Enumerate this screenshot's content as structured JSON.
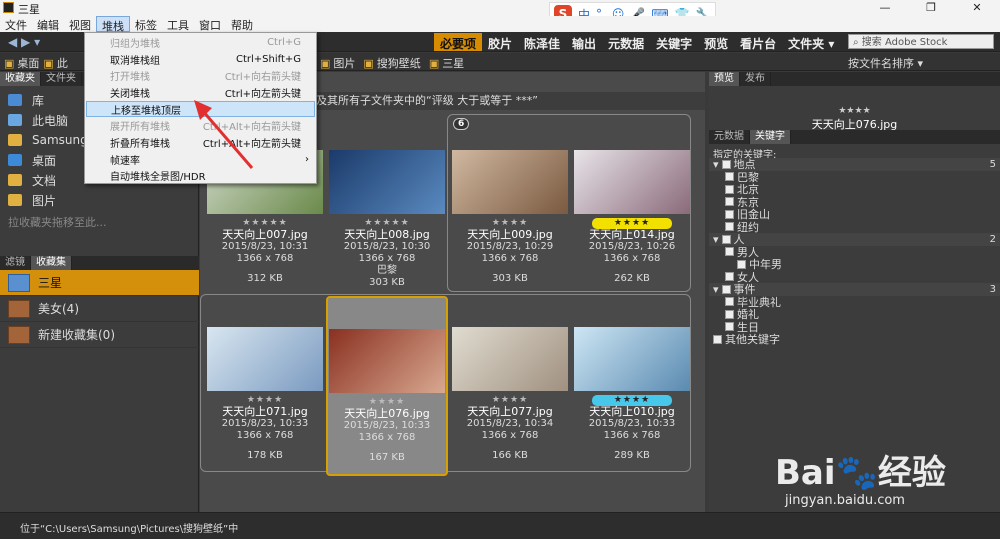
{
  "window": {
    "title": "三星",
    "controls": [
      "—",
      "❐",
      "✕"
    ]
  },
  "menubar": {
    "items": [
      "文件",
      "编辑",
      "视图",
      "堆栈",
      "标签",
      "工具",
      "窗口",
      "帮助"
    ],
    "active": "堆栈"
  },
  "ime": {
    "logo": "S",
    "items": [
      "中",
      "°,",
      "☺",
      "🎤",
      "⌨",
      "👕",
      "🔧"
    ]
  },
  "workspaces": {
    "items": [
      "必要项",
      "胶片",
      "陈泽佳",
      "输出",
      "元数据",
      "关键字",
      "预览",
      "看片台",
      "文件夹"
    ],
    "active": "必要项",
    "stock_placeholder": "搜索 Adobe Stock"
  },
  "pathbar": {
    "left": [
      "桌面",
      "此"
    ],
    "right": [
      "图片",
      "搜狗壁纸",
      "三星"
    ],
    "sort": "按文件名排序"
  },
  "stack_menu": {
    "items": [
      {
        "label": "归组为堆栈",
        "shortcut": "Ctrl+G",
        "disabled": true
      },
      {
        "label": "取消堆栈组",
        "shortcut": "Ctrl+Shift+G",
        "disabled": false
      },
      {
        "label": "打开堆栈",
        "shortcut": "Ctrl+向右箭头键",
        "disabled": true
      },
      {
        "label": "关闭堆栈",
        "shortcut": "Ctrl+向左箭头键",
        "disabled": false
      },
      {
        "label": "上移至堆栈顶层",
        "shortcut": "",
        "disabled": false,
        "highlight": true
      },
      {
        "label": "展开所有堆栈",
        "shortcut": "Ctrl+Alt+向右箭头键",
        "disabled": true
      },
      {
        "label": "折叠所有堆栈",
        "shortcut": "Ctrl+Alt+向左箭头键",
        "disabled": false
      },
      {
        "label": "帧速率",
        "shortcut": "",
        "disabled": false,
        "submenu": true
      },
      {
        "label": "自动堆栈全景图/HDR",
        "shortcut": "",
        "disabled": false
      }
    ]
  },
  "left_panel": {
    "tabs": [
      "收藏夹",
      "文件夹"
    ],
    "favorites": [
      {
        "label": "库",
        "color": "#4a8bd4"
      },
      {
        "label": "此电脑",
        "color": "#6aa6e0"
      },
      {
        "label": "Samsung",
        "color": "#e0b040"
      },
      {
        "label": "桌面",
        "color": "#3d8ad8"
      },
      {
        "label": "文档",
        "color": "#e0b040"
      },
      {
        "label": "图片",
        "color": "#e0b040"
      }
    ],
    "hint": "拉收藏夹拖移至此...",
    "bottom_tabs": [
      "滤镜",
      "收藏集"
    ],
    "collections": [
      {
        "label": "三星",
        "active": true
      },
      {
        "label": "美女(4)",
        "active": false
      },
      {
        "label": "新建收藏集(0)",
        "active": false
      }
    ]
  },
  "content": {
    "filter_text": "及其所有子文件夹中的“评级 大于或等于 ***”",
    "stack_count": "6",
    "cards": [
      {
        "name": "天天向上007.jpg",
        "date": "2015/8/23, 10:31",
        "dims": "1366 x 768",
        "size": "312 KB",
        "stars": "★★★★★",
        "badge": "",
        "loc": "",
        "img": [
          "#cfd8c8",
          "#6a8a4a"
        ]
      },
      {
        "name": "天天向上008.jpg",
        "date": "2015/8/23, 10:30",
        "dims": "1366 x 768",
        "size": "303 KB",
        "stars": "★★★★★",
        "badge": "",
        "loc": "巴黎",
        "img": [
          "#1a3a6a",
          "#5a8ac0"
        ]
      },
      {
        "name": "天天向上009.jpg",
        "date": "2015/8/23, 10:29",
        "dims": "1366 x 768",
        "size": "303 KB",
        "stars": "★★★★",
        "badge": "",
        "loc": "",
        "img": [
          "#d0b8a0",
          "#7a5a40"
        ]
      },
      {
        "name": "天天向上014.jpg",
        "date": "2015/8/23, 10:26",
        "dims": "1366 x 768",
        "size": "262 KB",
        "stars": "★★★★",
        "badge": "yellow",
        "loc": "",
        "img": [
          "#e8e4e8",
          "#8a6a7a"
        ]
      },
      {
        "name": "天天向上071.jpg",
        "date": "2015/8/23, 10:33",
        "dims": "1366 x 768",
        "size": "178 KB",
        "stars": "★★★★",
        "badge": "",
        "loc": "",
        "img": [
          "#d8e6f0",
          "#7a9ac0"
        ]
      },
      {
        "name": "天天向上076.jpg",
        "date": "2015/8/23, 10:33",
        "dims": "1366 x 768",
        "size": "167 KB",
        "stars": "★★★★",
        "badge": "",
        "loc": "",
        "img": [
          "#8a3020",
          "#d8a890"
        ]
      },
      {
        "name": "天天向上077.jpg",
        "date": "2015/8/23, 10:34",
        "dims": "1366 x 768",
        "size": "166 KB",
        "stars": "★★★★",
        "badge": "",
        "loc": "",
        "img": [
          "#e0dcd0",
          "#a09080"
        ]
      },
      {
        "name": "天天向上010.jpg",
        "date": "2015/8/23, 10:33",
        "dims": "1366 x 768",
        "size": "289 KB",
        "stars": "★★★★",
        "badge": "cyan",
        "loc": "",
        "img": [
          "#cde6f4",
          "#5a8ab0"
        ]
      }
    ]
  },
  "right_panel": {
    "tabs": [
      "预览",
      "发布"
    ],
    "preview_stars": "★★★★",
    "preview_name": "天天向上076.jpg",
    "kw_tabs": [
      "元数据",
      "关键字"
    ],
    "kw_title": "指定的关键字:",
    "keywords": [
      {
        "label": "地点",
        "cat": true,
        "count": "5",
        "indent": 0
      },
      {
        "label": "巴黎",
        "cat": false,
        "count": "",
        "indent": 1
      },
      {
        "label": "北京",
        "cat": false,
        "count": "",
        "indent": 1
      },
      {
        "label": "东京",
        "cat": false,
        "count": "",
        "indent": 1
      },
      {
        "label": "旧金山",
        "cat": false,
        "count": "",
        "indent": 1
      },
      {
        "label": "纽约",
        "cat": false,
        "count": "",
        "indent": 1
      },
      {
        "label": "人",
        "cat": true,
        "count": "2",
        "indent": 0
      },
      {
        "label": "男人",
        "cat": false,
        "count": "",
        "indent": 1
      },
      {
        "label": "中年男",
        "cat": false,
        "count": "",
        "indent": 2
      },
      {
        "label": "女人",
        "cat": false,
        "count": "",
        "indent": 1
      },
      {
        "label": "事件",
        "cat": true,
        "count": "3",
        "indent": 0
      },
      {
        "label": "毕业典礼",
        "cat": false,
        "count": "",
        "indent": 1
      },
      {
        "label": "婚礼",
        "cat": false,
        "count": "",
        "indent": 1
      },
      {
        "label": "生日",
        "cat": false,
        "count": "",
        "indent": 1
      },
      {
        "label": "其他关键字",
        "cat": false,
        "count": "",
        "indent": 0
      }
    ]
  },
  "status": {
    "path": "位于“C:\\Users\\Samsung\\Pictures\\搜狗壁纸”中"
  },
  "watermark": {
    "brand_a": "Bai",
    "brand_b": "经验",
    "url": "jingyan.baidu.com"
  }
}
